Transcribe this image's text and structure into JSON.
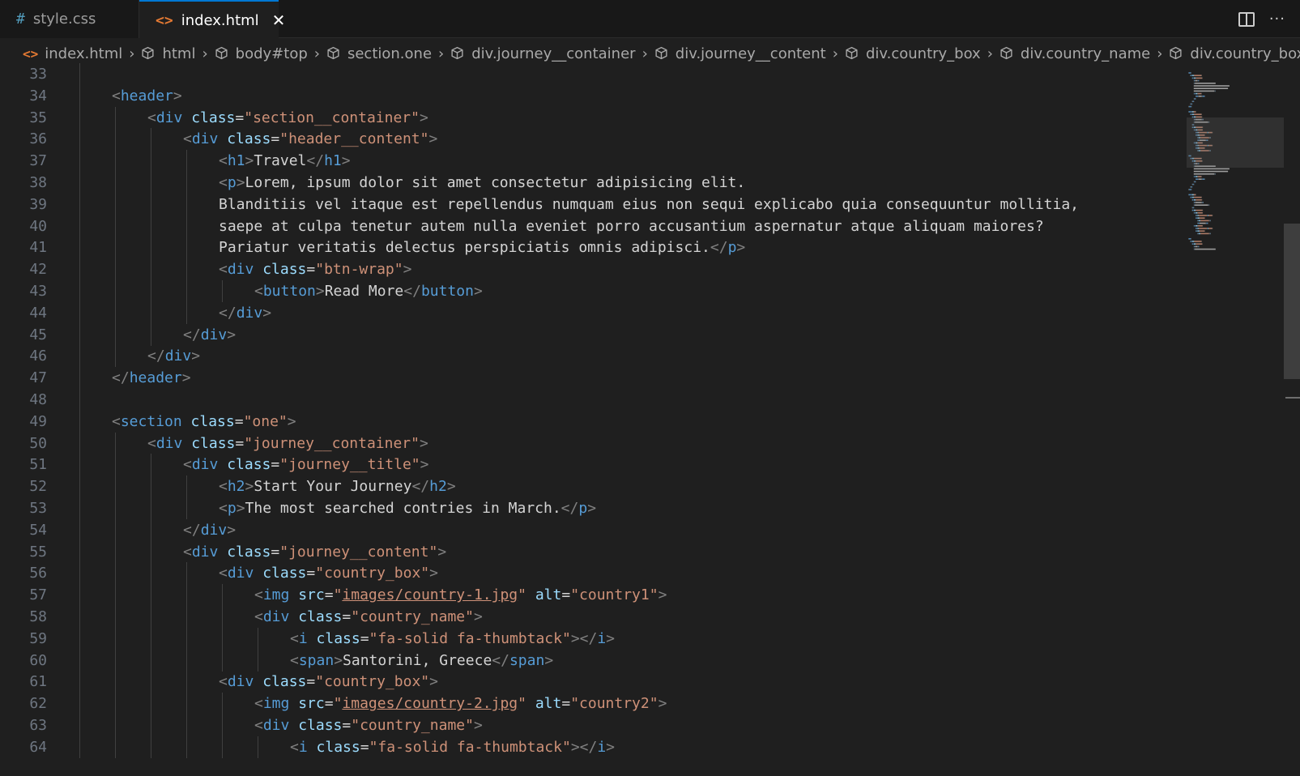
{
  "tabs": [
    {
      "icon": "#",
      "label": "style.css"
    },
    {
      "icon": "<>",
      "label": "index.html",
      "close": "✕"
    }
  ],
  "actions": {
    "more": "···"
  },
  "breadcrumb": [
    "index.html",
    "html",
    "body#top",
    "section.one",
    "div.journey__container",
    "div.journey__content",
    "div.country_box",
    "div.country_name",
    "div.country_box",
    "div.c"
  ],
  "lines": [
    {
      "n": "33",
      "indent": 1,
      "parts": []
    },
    {
      "n": "34",
      "indent": 1,
      "parts": [
        [
          "punc",
          "<"
        ],
        [
          "tag",
          "header"
        ],
        [
          "punc",
          ">"
        ]
      ]
    },
    {
      "n": "35",
      "indent": 2,
      "parts": [
        [
          "punc",
          "<"
        ],
        [
          "tag",
          "div"
        ],
        [
          "txt",
          " "
        ],
        [
          "attr",
          "class"
        ],
        [
          "txt",
          "="
        ],
        [
          "str",
          "\"section__container\""
        ],
        [
          "punc",
          ">"
        ]
      ]
    },
    {
      "n": "36",
      "indent": 3,
      "parts": [
        [
          "punc",
          "<"
        ],
        [
          "tag",
          "div"
        ],
        [
          "txt",
          " "
        ],
        [
          "attr",
          "class"
        ],
        [
          "txt",
          "="
        ],
        [
          "str",
          "\"header__content\""
        ],
        [
          "punc",
          ">"
        ]
      ]
    },
    {
      "n": "37",
      "indent": 4,
      "parts": [
        [
          "punc",
          "<"
        ],
        [
          "tag",
          "h1"
        ],
        [
          "punc",
          ">"
        ],
        [
          "txt",
          "Travel"
        ],
        [
          "punc",
          "</"
        ],
        [
          "tag",
          "h1"
        ],
        [
          "punc",
          ">"
        ]
      ]
    },
    {
      "n": "38",
      "indent": 4,
      "parts": [
        [
          "punc",
          "<"
        ],
        [
          "tag",
          "p"
        ],
        [
          "punc",
          ">"
        ],
        [
          "txt",
          "Lorem, ipsum dolor sit amet consectetur adipisicing elit."
        ]
      ]
    },
    {
      "n": "39",
      "indent": 4,
      "parts": [
        [
          "txt",
          "Blanditiis vel itaque est repellendus numquam eius non sequi explicabo quia consequuntur mollitia,"
        ]
      ]
    },
    {
      "n": "40",
      "indent": 4,
      "parts": [
        [
          "txt",
          "saepe at culpa tenetur autem nulla eveniet porro accusantium aspernatur atque aliquam maiores?"
        ]
      ]
    },
    {
      "n": "41",
      "indent": 4,
      "parts": [
        [
          "txt",
          "Pariatur veritatis delectus perspiciatis omnis adipisci."
        ],
        [
          "punc",
          "</"
        ],
        [
          "tag",
          "p"
        ],
        [
          "punc",
          ">"
        ]
      ]
    },
    {
      "n": "42",
      "indent": 4,
      "parts": [
        [
          "punc",
          "<"
        ],
        [
          "tag",
          "div"
        ],
        [
          "txt",
          " "
        ],
        [
          "attr",
          "class"
        ],
        [
          "txt",
          "="
        ],
        [
          "str",
          "\"btn-wrap\""
        ],
        [
          "punc",
          ">"
        ]
      ]
    },
    {
      "n": "43",
      "indent": 5,
      "parts": [
        [
          "punc",
          "<"
        ],
        [
          "tag",
          "button"
        ],
        [
          "punc",
          ">"
        ],
        [
          "txt",
          "Read More"
        ],
        [
          "punc",
          "</"
        ],
        [
          "tag",
          "button"
        ],
        [
          "punc",
          ">"
        ]
      ]
    },
    {
      "n": "44",
      "indent": 4,
      "parts": [
        [
          "punc",
          "</"
        ],
        [
          "tag",
          "div"
        ],
        [
          "punc",
          ">"
        ]
      ]
    },
    {
      "n": "45",
      "indent": 3,
      "parts": [
        [
          "punc",
          "</"
        ],
        [
          "tag",
          "div"
        ],
        [
          "punc",
          ">"
        ]
      ]
    },
    {
      "n": "46",
      "indent": 2,
      "parts": [
        [
          "punc",
          "</"
        ],
        [
          "tag",
          "div"
        ],
        [
          "punc",
          ">"
        ]
      ]
    },
    {
      "n": "47",
      "indent": 1,
      "parts": [
        [
          "punc",
          "</"
        ],
        [
          "tag",
          "header"
        ],
        [
          "punc",
          ">"
        ]
      ]
    },
    {
      "n": "48",
      "indent": 1,
      "parts": []
    },
    {
      "n": "49",
      "indent": 1,
      "parts": [
        [
          "punc",
          "<"
        ],
        [
          "tag",
          "section"
        ],
        [
          "txt",
          " "
        ],
        [
          "attr",
          "class"
        ],
        [
          "txt",
          "="
        ],
        [
          "str",
          "\"one\""
        ],
        [
          "punc",
          ">"
        ]
      ]
    },
    {
      "n": "50",
      "indent": 2,
      "parts": [
        [
          "punc",
          "<"
        ],
        [
          "tag",
          "div"
        ],
        [
          "txt",
          " "
        ],
        [
          "attr",
          "class"
        ],
        [
          "txt",
          "="
        ],
        [
          "str",
          "\"journey__container\""
        ],
        [
          "punc",
          ">"
        ]
      ]
    },
    {
      "n": "51",
      "indent": 3,
      "parts": [
        [
          "punc",
          "<"
        ],
        [
          "tag",
          "div"
        ],
        [
          "txt",
          " "
        ],
        [
          "attr",
          "class"
        ],
        [
          "txt",
          "="
        ],
        [
          "str",
          "\"journey__title\""
        ],
        [
          "punc",
          ">"
        ]
      ]
    },
    {
      "n": "52",
      "indent": 4,
      "parts": [
        [
          "punc",
          "<"
        ],
        [
          "tag",
          "h2"
        ],
        [
          "punc",
          ">"
        ],
        [
          "txt",
          "Start Your Journey"
        ],
        [
          "punc",
          "</"
        ],
        [
          "tag",
          "h2"
        ],
        [
          "punc",
          ">"
        ]
      ]
    },
    {
      "n": "53",
      "indent": 4,
      "parts": [
        [
          "punc",
          "<"
        ],
        [
          "tag",
          "p"
        ],
        [
          "punc",
          ">"
        ],
        [
          "txt",
          "The most searched contries in March."
        ],
        [
          "punc",
          "</"
        ],
        [
          "tag",
          "p"
        ],
        [
          "punc",
          ">"
        ]
      ]
    },
    {
      "n": "54",
      "indent": 3,
      "parts": [
        [
          "punc",
          "</"
        ],
        [
          "tag",
          "div"
        ],
        [
          "punc",
          ">"
        ]
      ]
    },
    {
      "n": "55",
      "indent": 3,
      "parts": [
        [
          "punc",
          "<"
        ],
        [
          "tag",
          "div"
        ],
        [
          "txt",
          " "
        ],
        [
          "attr",
          "class"
        ],
        [
          "txt",
          "="
        ],
        [
          "str",
          "\"journey__content\""
        ],
        [
          "punc",
          ">"
        ]
      ]
    },
    {
      "n": "56",
      "indent": 4,
      "parts": [
        [
          "punc",
          "<"
        ],
        [
          "tag",
          "div"
        ],
        [
          "txt",
          " "
        ],
        [
          "attr",
          "class"
        ],
        [
          "txt",
          "="
        ],
        [
          "str",
          "\"country_box\""
        ],
        [
          "punc",
          ">"
        ]
      ]
    },
    {
      "n": "57",
      "indent": 5,
      "parts": [
        [
          "punc",
          "<"
        ],
        [
          "tag",
          "img"
        ],
        [
          "txt",
          " "
        ],
        [
          "attr",
          "src"
        ],
        [
          "txt",
          "="
        ],
        [
          "str",
          "\""
        ],
        [
          "link",
          "images/country-1.jpg"
        ],
        [
          "str",
          "\""
        ],
        [
          "txt",
          " "
        ],
        [
          "attr",
          "alt"
        ],
        [
          "txt",
          "="
        ],
        [
          "str",
          "\"country1\""
        ],
        [
          "punc",
          ">"
        ]
      ]
    },
    {
      "n": "58",
      "indent": 5,
      "parts": [
        [
          "punc",
          "<"
        ],
        [
          "tag",
          "div"
        ],
        [
          "txt",
          " "
        ],
        [
          "attr",
          "class"
        ],
        [
          "txt",
          "="
        ],
        [
          "str",
          "\"country_name\""
        ],
        [
          "punc",
          ">"
        ]
      ]
    },
    {
      "n": "59",
      "indent": 6,
      "parts": [
        [
          "punc",
          "<"
        ],
        [
          "tag",
          "i"
        ],
        [
          "txt",
          " "
        ],
        [
          "attr",
          "class"
        ],
        [
          "txt",
          "="
        ],
        [
          "str",
          "\"fa-solid fa-thumbtack\""
        ],
        [
          "punc",
          "></"
        ],
        [
          "tag",
          "i"
        ],
        [
          "punc",
          ">"
        ]
      ]
    },
    {
      "n": "60",
      "indent": 6,
      "parts": [
        [
          "punc",
          "<"
        ],
        [
          "tag",
          "span"
        ],
        [
          "punc",
          ">"
        ],
        [
          "txt",
          "Santorini, Greece"
        ],
        [
          "punc",
          "</"
        ],
        [
          "tag",
          "span"
        ],
        [
          "punc",
          ">"
        ]
      ]
    },
    {
      "n": "61",
      "indent": 4,
      "parts": [
        [
          "punc",
          "<"
        ],
        [
          "tag",
          "div"
        ],
        [
          "txt",
          " "
        ],
        [
          "attr",
          "class"
        ],
        [
          "txt",
          "="
        ],
        [
          "str",
          "\"country_box\""
        ],
        [
          "punc",
          ">"
        ]
      ]
    },
    {
      "n": "62",
      "indent": 5,
      "parts": [
        [
          "punc",
          "<"
        ],
        [
          "tag",
          "img"
        ],
        [
          "txt",
          " "
        ],
        [
          "attr",
          "src"
        ],
        [
          "txt",
          "="
        ],
        [
          "str",
          "\""
        ],
        [
          "link",
          "images/country-2.jpg"
        ],
        [
          "str",
          "\""
        ],
        [
          "txt",
          " "
        ],
        [
          "attr",
          "alt"
        ],
        [
          "txt",
          "="
        ],
        [
          "str",
          "\"country2\""
        ],
        [
          "punc",
          ">"
        ]
      ]
    },
    {
      "n": "63",
      "indent": 5,
      "parts": [
        [
          "punc",
          "<"
        ],
        [
          "tag",
          "div"
        ],
        [
          "txt",
          " "
        ],
        [
          "attr",
          "class"
        ],
        [
          "txt",
          "="
        ],
        [
          "str",
          "\"country_name\""
        ],
        [
          "punc",
          ">"
        ]
      ]
    },
    {
      "n": "64",
      "indent": 6,
      "parts": [
        [
          "punc",
          "<"
        ],
        [
          "tag",
          "i"
        ],
        [
          "txt",
          " "
        ],
        [
          "attr",
          "class"
        ],
        [
          "txt",
          "="
        ],
        [
          "str",
          "\"fa-solid fa-thumbtack\""
        ],
        [
          "punc",
          "></"
        ],
        [
          "tag",
          "i"
        ],
        [
          "punc",
          ">"
        ]
      ]
    }
  ]
}
